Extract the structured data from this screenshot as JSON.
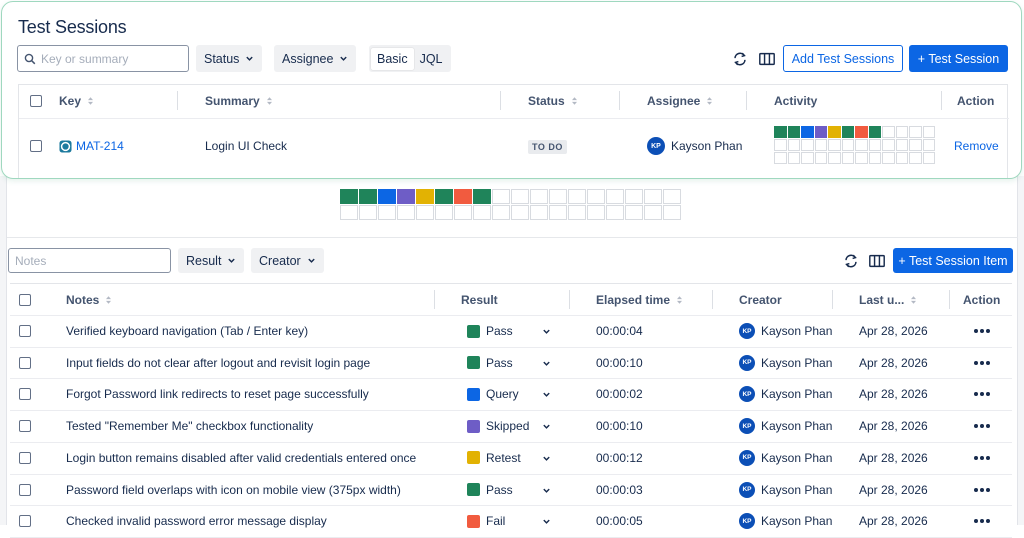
{
  "sessions": {
    "title": "Test Sessions",
    "search": {
      "placeholder": "Key or summary",
      "value": ""
    },
    "filters": [
      {
        "label": "Status"
      },
      {
        "label": "Assignee"
      }
    ],
    "mode_toggle": {
      "options": [
        "Basic",
        "JQL"
      ],
      "selected": "Basic"
    },
    "buttons": {
      "add_sessions": "Add Test Sessions",
      "new_session": "+ Test Session"
    },
    "columns": [
      "Key",
      "Summary",
      "Status",
      "Assignee",
      "Activity",
      "Action"
    ],
    "rows": [
      {
        "key": "MAT-214",
        "summary": "Login UI Check",
        "status": "TO DO",
        "assignee": "Kayson Phan",
        "assignee_initials": "KP",
        "action": "Remove",
        "activity_colors": [
          "#1f845a",
          "#1f845a",
          "#0c66e4",
          "#6e5dc6",
          "#e2b203",
          "#1f845a",
          "#f15b3f",
          "#1f845a"
        ]
      }
    ]
  },
  "progress_strip": {
    "colors": [
      "#1f845a",
      "#1f845a",
      "#0c66e4",
      "#6e5dc6",
      "#e2b203",
      "#1f845a",
      "#f15b3f",
      "#1f845a"
    ]
  },
  "items": {
    "search": {
      "placeholder": "Notes",
      "value": ""
    },
    "filters": [
      {
        "label": "Result"
      },
      {
        "label": "Creator"
      }
    ],
    "buttons": {
      "new_item": "+ Test Session Item"
    },
    "columns": [
      "Notes",
      "Result",
      "Elapsed time",
      "Creator",
      "Last u...",
      "Action"
    ],
    "rows": [
      {
        "notes": "Verified keyboard navigation (Tab / Enter key)",
        "result": "Pass",
        "result_color": "#1f845a",
        "elapsed": "00:00:04",
        "creator": "Kayson Phan",
        "initials": "KP",
        "last_updated": "Apr 28, 2026"
      },
      {
        "notes": "Input fields do not clear after logout and revisit login page",
        "result": "Pass",
        "result_color": "#1f845a",
        "elapsed": "00:00:10",
        "creator": "Kayson Phan",
        "initials": "KP",
        "last_updated": "Apr 28, 2026"
      },
      {
        "notes": "Forgot Password link redirects to reset page successfully",
        "result": "Query",
        "result_color": "#0c66e4",
        "elapsed": "00:00:02",
        "creator": "Kayson Phan",
        "initials": "KP",
        "last_updated": "Apr 28, 2026"
      },
      {
        "notes": "Tested \"Remember Me\" checkbox functionality",
        "result": "Skipped",
        "result_color": "#6e5dc6",
        "elapsed": "00:00:10",
        "creator": "Kayson Phan",
        "initials": "KP",
        "last_updated": "Apr 28, 2026"
      },
      {
        "notes": "Login button remains disabled after valid credentials entered once",
        "result": "Retest",
        "result_color": "#e2b203",
        "elapsed": "00:00:12",
        "creator": "Kayson Phan",
        "initials": "KP",
        "last_updated": "Apr 28, 2026"
      },
      {
        "notes": "Password field overlaps with icon on mobile view (375px width)",
        "result": "Pass",
        "result_color": "#1f845a",
        "elapsed": "00:00:03",
        "creator": "Kayson Phan",
        "initials": "KP",
        "last_updated": "Apr 28, 2026"
      },
      {
        "notes": "Checked invalid password error message display",
        "result": "Fail",
        "result_color": "#f15b3f",
        "elapsed": "00:00:05",
        "creator": "Kayson Phan",
        "initials": "KP",
        "last_updated": "Apr 28, 2026"
      }
    ]
  },
  "icons": {
    "search": "search-icon",
    "refresh": "refresh-icon",
    "columns": "columns-icon",
    "chevron": "chevron-down-icon",
    "sort": "sort-icon",
    "status": "session-status-icon",
    "more": "more-icon"
  },
  "colors": {
    "accent": "#0c66e4",
    "highlight_border": "#9fd8bf",
    "avatar": "#0c4fb6"
  }
}
